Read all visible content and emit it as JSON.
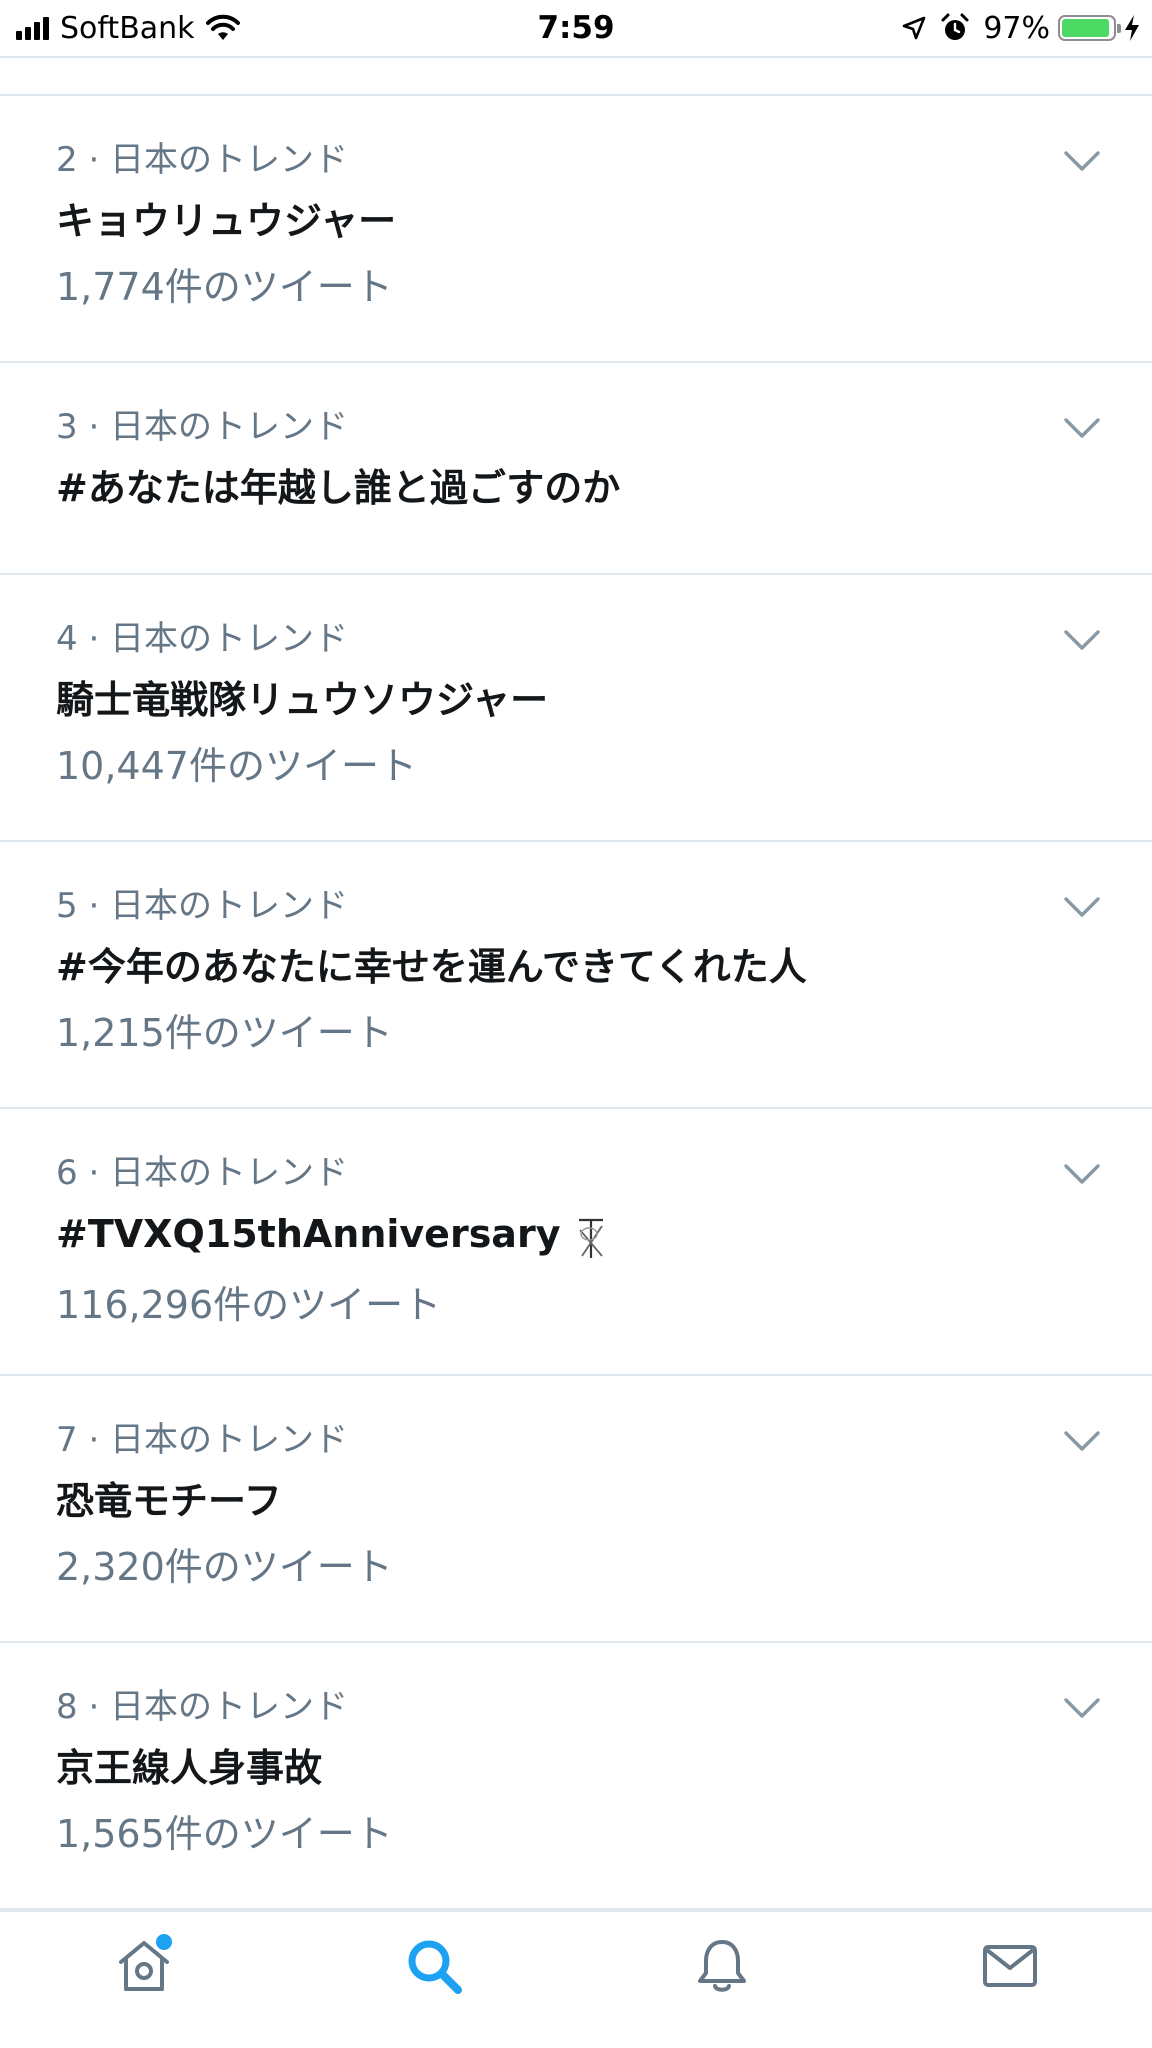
{
  "status_bar": {
    "carrier": "SoftBank",
    "time": "7:59",
    "battery_percent": "97%",
    "battery_level": 0.97,
    "battery_color": "#4cd964"
  },
  "colors": {
    "accent": "#1da1f2",
    "primary_text": "#14171a",
    "secondary_text": "#657786",
    "divider": "#e1e8ed"
  },
  "trends": [
    {
      "rank_label": "2 · 日本のトレンド",
      "name": "キョウリュウジャー",
      "tweet_count": "1,774件のツイート"
    },
    {
      "rank_label": "3 · 日本のトレンド",
      "name": "#あなたは年越し誰と過ごすのか",
      "tweet_count": ""
    },
    {
      "rank_label": "4 · 日本のトレンド",
      "name": "騎士竜戦隊リュウソウジャー",
      "tweet_count": "10,447件のツイート"
    },
    {
      "rank_label": "5 · 日本のトレンド",
      "name": "#今年のあなたに幸せを運んできてくれた人",
      "tweet_count": "1,215件のツイート"
    },
    {
      "rank_label": "6 · 日本のトレンド",
      "name": "#TVXQ15thAnniversary",
      "tweet_count": "116,296件のツイート",
      "hashflag_icon": "tvxq-hashflag-icon"
    },
    {
      "rank_label": "7 · 日本のトレンド",
      "name": "恐竜モチーフ",
      "tweet_count": "2,320件のツイート"
    },
    {
      "rank_label": "8 · 日本のトレンド",
      "name": "京王線人身事故",
      "tweet_count": "1,565件のツイート"
    }
  ],
  "tab_bar": {
    "tabs": [
      {
        "icon": "home-icon",
        "active": false,
        "has_badge": true
      },
      {
        "icon": "search-icon",
        "active": true,
        "has_badge": false
      },
      {
        "icon": "bell-icon",
        "active": false,
        "has_badge": false
      },
      {
        "icon": "mail-icon",
        "active": false,
        "has_badge": false
      }
    ]
  }
}
